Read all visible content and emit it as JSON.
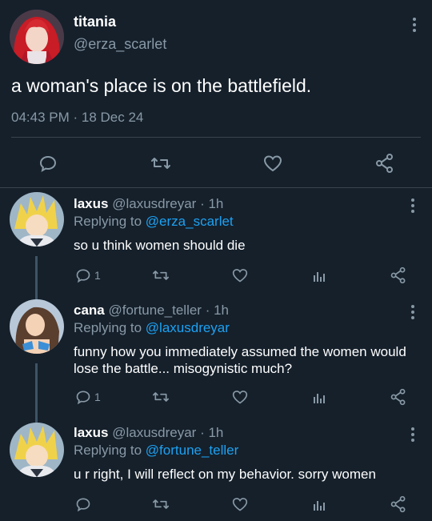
{
  "main_tweet": {
    "display_name": "titania",
    "handle": "@erza_scarlet",
    "text": "a woman's place is on the battlefield.",
    "timestamp": "04:43 PM · 18 Dec 24"
  },
  "replies": [
    {
      "display_name": "laxus",
      "handle_time": "@laxusdreyar · 1h",
      "replying_prefix": "Replying to",
      "replying_to": "@erza_scarlet",
      "text": "so u think women should die",
      "reply_count": "1"
    },
    {
      "display_name": "cana",
      "handle_time": "@fortune_teller · 1h",
      "replying_prefix": "Replying to",
      "replying_to": "@laxusdreyar",
      "text": "funny how you immediately assumed the women would lose the battle... misogynistic much?",
      "reply_count": "1"
    },
    {
      "display_name": "laxus",
      "handle_time": "@laxusdreyar · 1h",
      "replying_prefix": "Replying to",
      "replying_to": "@fortune_teller",
      "text": "u r right, I will reflect on my behavior. sorry women",
      "reply_count": ""
    }
  ],
  "icons": [
    "reply-icon",
    "retweet-icon",
    "like-icon",
    "share-icon",
    "analytics-icon",
    "more-icon"
  ],
  "colors": {
    "background": "#15202b",
    "secondary_text": "#8899a6",
    "link": "#1da1f2",
    "divider": "#38444d"
  }
}
